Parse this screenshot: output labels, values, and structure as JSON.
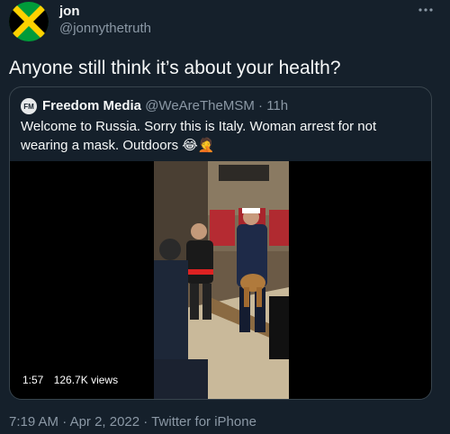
{
  "author": {
    "name": "jon",
    "handle": "@jonnythetruth",
    "avatar_icon": "jamaica-flag-icon"
  },
  "more_icon": "more-options-icon",
  "tweet": {
    "text": "Anyone still think it’s about your health?"
  },
  "quoted_tweet": {
    "avatar_text": "FM",
    "name": "Freedom Media",
    "handle": "@WeAreTheMSM",
    "separator": "·",
    "time_ago": "11h",
    "text": "Welcome to Russia. Sorry this is Italy. Woman arrest for not wearing a mask. Outdoors",
    "emoji": "😂🤦",
    "video": {
      "duration": "1:57",
      "views": "126.7K views"
    }
  },
  "footer": {
    "time": "7:19 AM",
    "date": "Apr 2, 2022",
    "source": "Twitter for iPhone",
    "separator": "·"
  }
}
